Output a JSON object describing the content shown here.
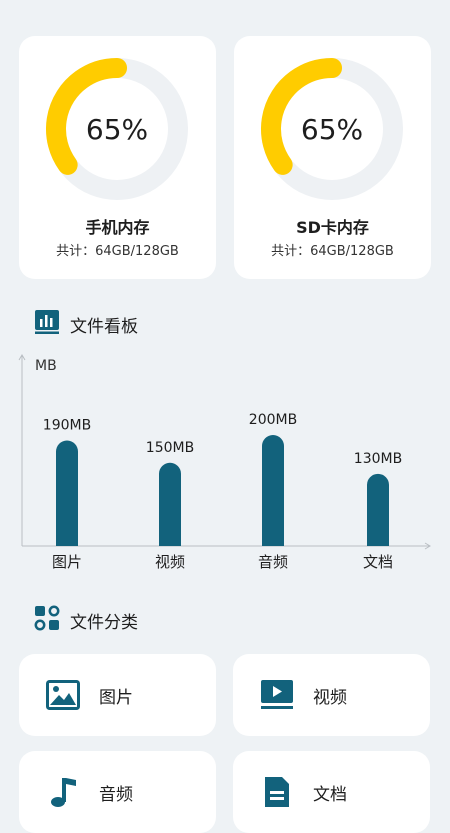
{
  "colors": {
    "accent": "#ffcc00",
    "track": "#eef1f4",
    "primary": "#12627c",
    "background": "#eef2f5"
  },
  "storage": [
    {
      "title": "手机内存",
      "total": "共计：64GB/128GB",
      "percent_label": "65%",
      "used_fraction": 0.35
    },
    {
      "title": "SD卡内存",
      "total": "共计：64GB/128GB",
      "percent_label": "65%",
      "used_fraction": 0.35
    }
  ],
  "board": {
    "title": "文件看板",
    "icon": "bar-chart-icon"
  },
  "chart_data": {
    "type": "bar",
    "ylabel": "MB",
    "categories": [
      "图片",
      "视频",
      "音频",
      "文档"
    ],
    "values": [
      190,
      150,
      200,
      130
    ],
    "value_labels": [
      "190MB",
      "150MB",
      "200MB",
      "130MB"
    ],
    "ylim": [
      0,
      200
    ],
    "grid": false
  },
  "category_section": {
    "title": "文件分类",
    "icon": "category-grid-icon"
  },
  "categories": [
    {
      "label": "图片",
      "icon": "image-icon"
    },
    {
      "label": "视频",
      "icon": "video-icon"
    },
    {
      "label": "音频",
      "icon": "music-icon"
    },
    {
      "label": "文档",
      "icon": "document-icon"
    }
  ]
}
